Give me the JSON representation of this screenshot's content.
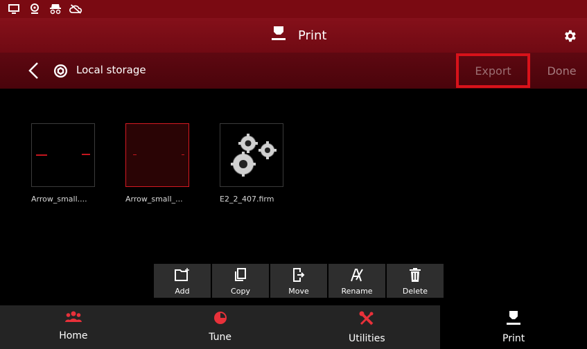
{
  "status_icons": [
    "monitor-icon",
    "webcam-icon",
    "incognito-icon",
    "cloud-off-icon"
  ],
  "header": {
    "title": "Print",
    "icon": "printer-icon",
    "settings_icon": "gear-icon"
  },
  "nav": {
    "back_icon": "chevron-left-icon",
    "storage_icon": "storage-icon",
    "location": "Local storage",
    "export_label": "Export",
    "done_label": "Done"
  },
  "files": [
    {
      "name": "Arrow_small....",
      "selected": false
    },
    {
      "name": "Arrow_small_...",
      "selected": true
    },
    {
      "name": "E2_2_407.firm",
      "selected": false
    }
  ],
  "toolbar": {
    "add": "Add",
    "copy": "Copy",
    "move": "Move",
    "rename": "Rename",
    "delete": "Delete"
  },
  "tabs": [
    {
      "label": "Home",
      "icon": "people-icon"
    },
    {
      "label": "Tune",
      "icon": "pie-chart-icon"
    },
    {
      "label": "Utilities",
      "icon": "tools-icon"
    },
    {
      "label": "Print",
      "icon": "printer-icon",
      "active": true
    }
  ],
  "colors": {
    "accent": "#d61a22",
    "header": "#7a0a12",
    "nav": "#560610",
    "tabbar": "#242424"
  }
}
